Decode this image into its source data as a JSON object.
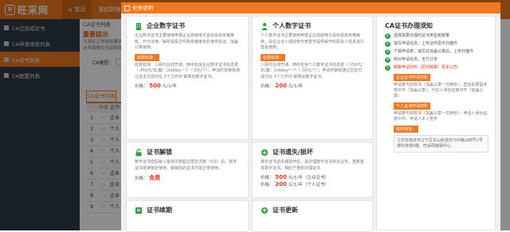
{
  "app": {
    "logo_mark": "≡",
    "logo_text": "旺采网",
    "nav": [
      {
        "label": "首页",
        "icon": "home-icon"
      },
      {
        "label": "基础数据",
        "icon": "data-icon"
      }
    ]
  },
  "sidebar": {
    "items": [
      {
        "label": "CA已放成证书",
        "active": false
      },
      {
        "label": "CA申请审核列表",
        "active": false
      },
      {
        "label": "CA证书列表",
        "active": true
      },
      {
        "label": "CA配置列表",
        "active": false
      }
    ]
  },
  "content": {
    "breadcrumb": "CA证书列表",
    "tip_title": "重要提示",
    "tip_lines": [
      "为满足正常投标要求并进行上投标",
      "业务需要在旺采网使用电子"
    ],
    "filter_label": "CA类型：",
    "list_tab": "CA证书列表",
    "grid_headers": [
      "收藏",
      "证书"
    ],
    "grid_rows": [
      {
        "num": "1",
        "text": "企业"
      },
      {
        "num": "2",
        "text": "个人"
      },
      {
        "num": "3",
        "text": "个人"
      },
      {
        "num": "4",
        "text": "个人"
      },
      {
        "num": "5",
        "text": "个人"
      },
      {
        "num": "6",
        "text": "企业"
      },
      {
        "num": "7",
        "text": "企业"
      },
      {
        "num": "8",
        "text": "企业"
      },
      {
        "num": "9",
        "text": "个人"
      }
    ]
  },
  "modal": {
    "title": "业务说明",
    "cards": [
      {
        "title": "企业数字证书",
        "icon": "building-icon",
        "desc": "企业数字证书主要使用申报企业高级电子投标投标资格审核，作为法律，解析投投文件和资格审定的身份验证、加盖公章使用。",
        "badge": "收费标准：",
        "fee": "收费标准：入网与在线开通，两中包含企业数字证书信息费（ 450元/年/套）UsbKey一个（ 0元/个）；申请时效审核通过且支付成功在 3个工作日 邮寄出数字证书。",
        "fee_ex": "450元/年/套",
        "price_label": "价格：",
        "price": "500",
        "unit": "元/1/年"
      },
      {
        "title": "个人数字证书",
        "icon": "person-icon",
        "desc": "个人数字证书主要使用申报企业高级电子投标投标资格审核，由企业法人或授权代表签字提供操作的投标人信息进行签名使用。",
        "badge": "收费标准：",
        "fee": "入网与在线开通，两中包含个人数字证书信息费（ 150元/年/套）UsbKey一个（ 50元/个）；申请时审核通过且支付成功在 3个工作日 邮寄出数字证书。",
        "fee_ex": "150元/年/套",
        "price_label": "价格：",
        "price": "200",
        "unit": "元/1/年"
      },
      {
        "title": "证书解锁",
        "icon": "unlock-icon",
        "desc": "数字证书密码输入错误次数超过限定次数（5次）后，数字证书将被锁定使用，解锁后的证书方能正常使用。",
        "price_label": "价格：",
        "price": "免费",
        "unit": ""
      },
      {
        "title": "证书遗失/损坏",
        "icon": "repair-icon",
        "desc": "数字证书遗失或损坏后，需办理数字证书补办业务，重新签发数字证书。相应于重新办理证书",
        "price_lines": [
          {
            "label": "价格：",
            "price": "500",
            "unit": "元/1/年（企业证书）"
          },
          {
            "label": "价格：",
            "price": "200",
            "unit": "元/1/年（个人证书）"
          }
        ]
      },
      {
        "title": "证书续期",
        "icon": "renew-icon"
      },
      {
        "title": "证书更新",
        "icon": "update-icon"
      }
    ],
    "right": {
      "title": "CA证书办理须知",
      "steps": [
        {
          "n": "1",
          "text": "选择需要办理的证书类型和数量",
          "link": false
        },
        {
          "n": "2",
          "text": "填写申请信息，上传证件原件扫描件",
          "link": false
        },
        {
          "n": "3",
          "text": "下载申请表，填写并加盖公章后，上传扫描件",
          "link": false
        },
        {
          "n": "4",
          "text": "核对申请信息，支付订单",
          "link": false
        },
        {
          "n": "5",
          "text": "邮寄申请材料（原件邮寄）至本公司",
          "link": true
        }
      ],
      "sub1": "企业证书申请材料",
      "sub1_text": "申请表与授权书（加盖公章一式两份）；营业执照副本复印件（加盖公章）；代办人身份证复印件（加盖公章）",
      "sub2": "个人证书申请材料",
      "sub2_text": "申请表与授权书（加盖公章一式两份）；申请人身份证复印件，申请人本人签字",
      "sub3": "收件地址：",
      "address": "江苏省南京市江宁区东山街道天元中路188号1号楼科技楼9楼，旺采网客服中心"
    }
  }
}
